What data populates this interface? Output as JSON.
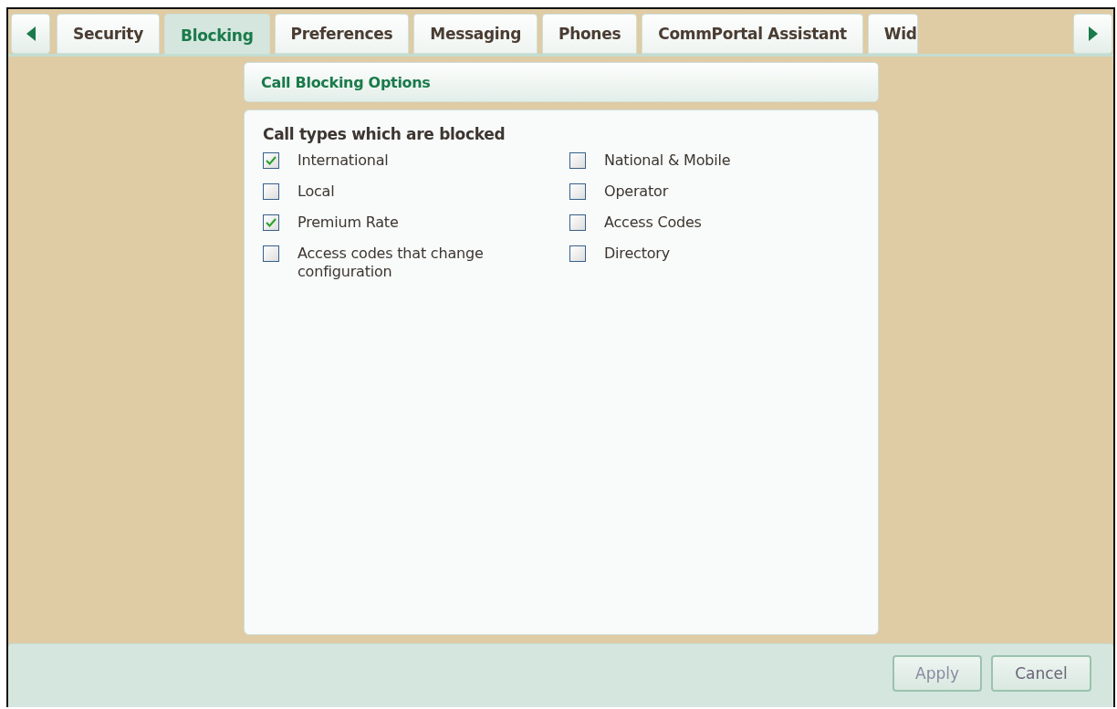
{
  "tabs": [
    {
      "label": "Security",
      "selected": false
    },
    {
      "label": "Blocking",
      "selected": true
    },
    {
      "label": "Preferences",
      "selected": false
    },
    {
      "label": "Messaging",
      "selected": false
    },
    {
      "label": "Phones",
      "selected": false
    },
    {
      "label": "CommPortal Assistant",
      "selected": false
    },
    {
      "label": "Wid",
      "selected": false
    }
  ],
  "panel": {
    "title": "Call Blocking Options",
    "section_heading": "Call types which are blocked",
    "options": [
      {
        "label": "International",
        "checked": true
      },
      {
        "label": "National & Mobile",
        "checked": false
      },
      {
        "label": "Local",
        "checked": false
      },
      {
        "label": "Operator",
        "checked": false
      },
      {
        "label": "Premium Rate",
        "checked": true
      },
      {
        "label": "Access Codes",
        "checked": false
      },
      {
        "label": "Access codes that change configuration",
        "checked": false
      },
      {
        "label": "Directory",
        "checked": false
      }
    ]
  },
  "buttons": [
    {
      "label": "Apply",
      "disabled": true
    },
    {
      "label": "Cancel",
      "disabled": false
    }
  ]
}
